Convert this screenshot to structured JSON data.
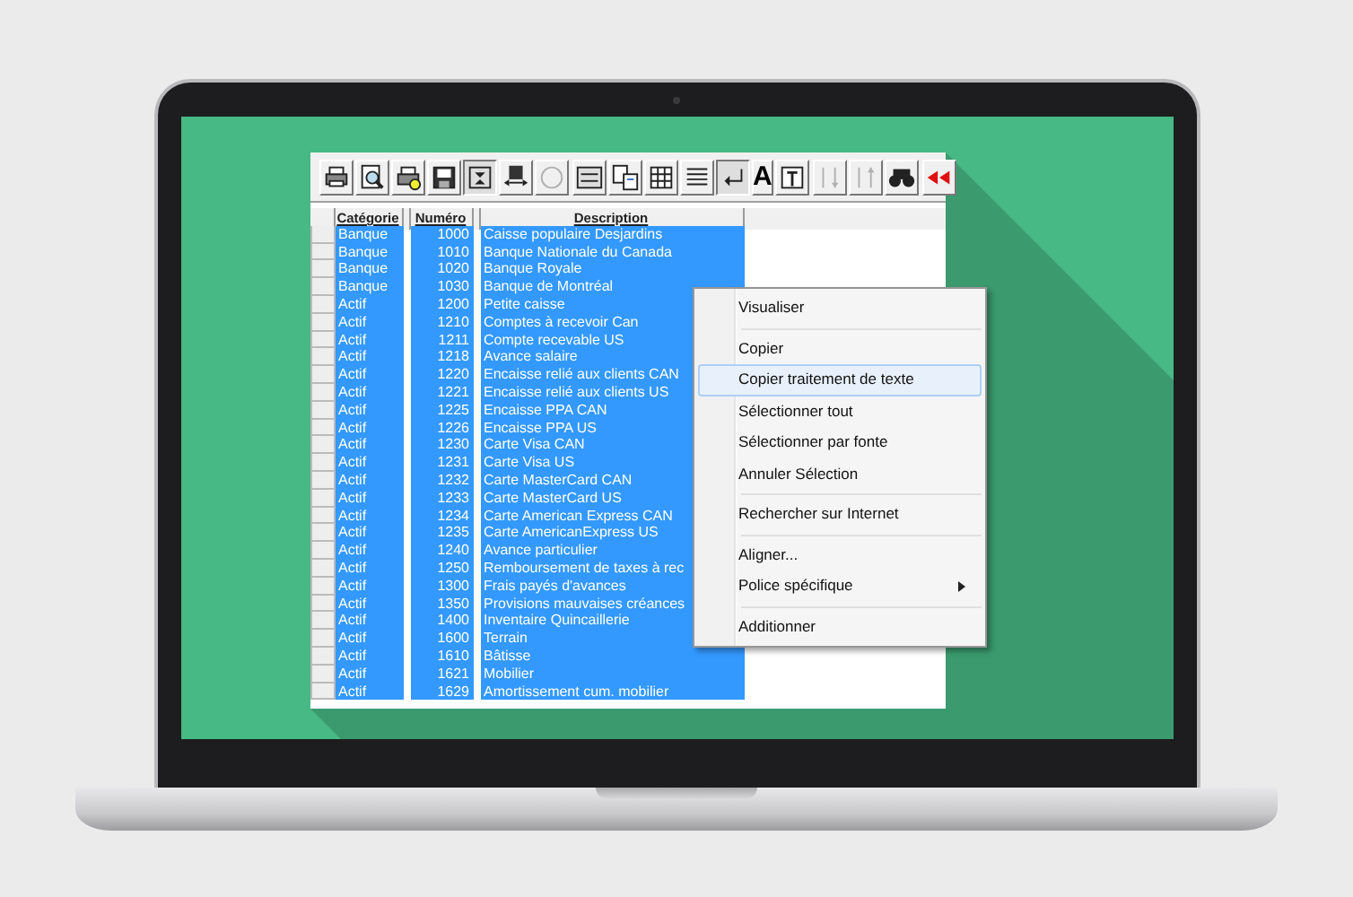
{
  "toolbar": [
    {
      "kind": "print",
      "pressed": false,
      "disabled": false
    },
    {
      "kind": "preview",
      "pressed": false,
      "disabled": false
    },
    {
      "kind": "setup",
      "pressed": false,
      "disabled": false
    },
    {
      "kind": "save",
      "pressed": false,
      "disabled": false
    },
    {
      "kind": "fit",
      "pressed": true,
      "disabled": false
    },
    {
      "kind": "saveas",
      "pressed": false,
      "disabled": false
    },
    {
      "kind": "circle",
      "pressed": false,
      "disabled": true
    },
    {
      "kind": "gap"
    },
    {
      "kind": "dos",
      "pressed": false,
      "disabled": false
    },
    {
      "kind": "copy",
      "pressed": false,
      "disabled": false
    },
    {
      "kind": "grid",
      "pressed": false,
      "disabled": false
    },
    {
      "kind": "lines",
      "pressed": false,
      "disabled": false
    },
    {
      "kind": "wrap",
      "pressed": true,
      "disabled": false
    },
    {
      "kind": "font",
      "label": "A",
      "pressed": false,
      "disabled": false
    },
    {
      "kind": "frame",
      "pressed": false,
      "disabled": false
    },
    {
      "kind": "gap"
    },
    {
      "kind": "sortup",
      "pressed": false,
      "disabled": true
    },
    {
      "kind": "sortdown",
      "pressed": false,
      "disabled": true
    },
    {
      "kind": "find",
      "pressed": false,
      "disabled": false
    },
    {
      "kind": "gap"
    },
    {
      "kind": "back",
      "pressed": false,
      "disabled": false
    }
  ],
  "table": {
    "columns": [
      "Catégorie",
      "Numéro",
      "Description"
    ],
    "rows": [
      {
        "category": "Banque",
        "number": "1000",
        "description": "Caisse populaire Desjardins",
        "selected": true
      },
      {
        "category": "Banque",
        "number": "1010",
        "description": "Banque Nationale du Canada",
        "selected": true
      },
      {
        "category": "Banque",
        "number": "1020",
        "description": "Banque Royale",
        "selected": true
      },
      {
        "category": "Banque",
        "number": "1030",
        "description": "Banque de Montréal",
        "selected": true
      },
      {
        "category": "Actif",
        "number": "1200",
        "description": "Petite caisse",
        "selected": true
      },
      {
        "category": "Actif",
        "number": "1210",
        "description": "Comptes à recevoir Can",
        "selected": true
      },
      {
        "category": "Actif",
        "number": "1211",
        "description": "Compte recevable US",
        "selected": true
      },
      {
        "category": "Actif",
        "number": "1218",
        "description": "Avance salaire",
        "selected": true
      },
      {
        "category": "Actif",
        "number": "1220",
        "description": "Encaisse relié aux clients CAN",
        "selected": true
      },
      {
        "category": "Actif",
        "number": "1221",
        "description": "Encaisse relié aux clients US",
        "selected": true
      },
      {
        "category": "Actif",
        "number": "1225",
        "description": "Encaisse PPA CAN",
        "selected": true
      },
      {
        "category": "Actif",
        "number": "1226",
        "description": "Encaisse PPA US",
        "selected": true
      },
      {
        "category": "Actif",
        "number": "1230",
        "description": "Carte Visa CAN",
        "selected": true
      },
      {
        "category": "Actif",
        "number": "1231",
        "description": "Carte Visa US",
        "selected": true
      },
      {
        "category": "Actif",
        "number": "1232",
        "description": "Carte MasterCard CAN",
        "selected": true
      },
      {
        "category": "Actif",
        "number": "1233",
        "description": "Carte MasterCard US",
        "selected": true
      },
      {
        "category": "Actif",
        "number": "1234",
        "description": "Carte American Express CAN",
        "selected": true
      },
      {
        "category": "Actif",
        "number": "1235",
        "description": "Carte AmericanExpress US",
        "selected": true
      },
      {
        "category": "Actif",
        "number": "1240",
        "description": "Avance particulier",
        "selected": true
      },
      {
        "category": "Actif",
        "number": "1250",
        "description": "Remboursement de taxes à rec",
        "selected": true
      },
      {
        "category": "Actif",
        "number": "1300",
        "description": "Frais payés d'avances",
        "selected": true
      },
      {
        "category": "Actif",
        "number": "1350",
        "description": "Provisions mauvaises créances",
        "selected": true
      },
      {
        "category": "Actif",
        "number": "1400",
        "description": "Inventaire Quincaillerie",
        "selected": true
      },
      {
        "category": "Actif",
        "number": "1600",
        "description": "Terrain",
        "selected": true
      },
      {
        "category": "Actif",
        "number": "1610",
        "description": "Bâtisse",
        "selected": true
      },
      {
        "category": "Actif",
        "number": "1621",
        "description": "Mobilier",
        "selected": true
      },
      {
        "category": "Actif",
        "number": "1629",
        "description": "Amortissement cum. mobilier",
        "selected": true
      }
    ]
  },
  "context_menu": {
    "items": [
      {
        "kind": "item",
        "label": "Visualiser",
        "highlighted": false,
        "submenu": false
      },
      {
        "kind": "separator"
      },
      {
        "kind": "item",
        "label": "Copier",
        "highlighted": false,
        "submenu": false
      },
      {
        "kind": "item",
        "label": "Copier traitement de texte",
        "highlighted": true,
        "submenu": false
      },
      {
        "kind": "item",
        "label": "Sélectionner tout",
        "highlighted": false,
        "submenu": false
      },
      {
        "kind": "item",
        "label": "Sélectionner par fonte",
        "highlighted": false,
        "submenu": false
      },
      {
        "kind": "item",
        "label": "Annuler Sélection",
        "highlighted": false,
        "submenu": false
      },
      {
        "kind": "separator"
      },
      {
        "kind": "item",
        "label": "Rechercher sur Internet",
        "highlighted": false,
        "submenu": false
      },
      {
        "kind": "separator"
      },
      {
        "kind": "item",
        "label": "Aligner...",
        "highlighted": false,
        "submenu": false
      },
      {
        "kind": "item",
        "label": "Police spécifique",
        "highlighted": false,
        "submenu": true
      },
      {
        "kind": "separator"
      },
      {
        "kind": "item",
        "label": "Additionner",
        "highlighted": false,
        "submenu": false
      }
    ]
  }
}
